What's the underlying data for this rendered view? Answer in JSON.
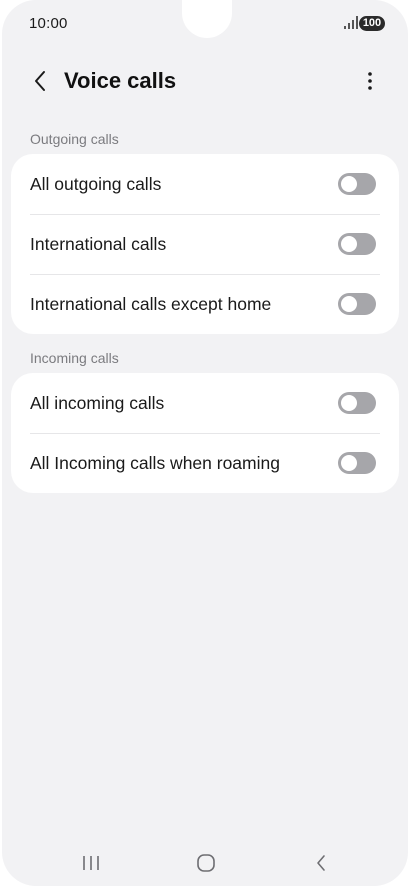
{
  "status_bar": {
    "time": "10:00",
    "battery": "100",
    "icons": [
      "signal-icon",
      "battery-icon"
    ]
  },
  "app_bar": {
    "title": "Voice calls",
    "icons": [
      "back-arrow-icon",
      "more-vertical-icon"
    ]
  },
  "sections": [
    {
      "label": "Outgoing calls",
      "items": [
        {
          "label": "All outgoing calls",
          "enabled": false
        },
        {
          "label": "International calls",
          "enabled": false
        },
        {
          "label": "International calls except home",
          "enabled": false
        }
      ]
    },
    {
      "label": "Incoming calls",
      "items": [
        {
          "label": "All incoming calls",
          "enabled": false
        },
        {
          "label": "All Incoming calls when roaming",
          "enabled": false
        }
      ]
    }
  ],
  "nav_bar": {
    "icons": [
      "recents-icon",
      "home-icon",
      "back-icon"
    ]
  },
  "colors": {
    "background": "#f2f2f4",
    "card": "#ffffff",
    "toggle_off": "#a6a6aa",
    "section_label": "#7b7b7f"
  }
}
